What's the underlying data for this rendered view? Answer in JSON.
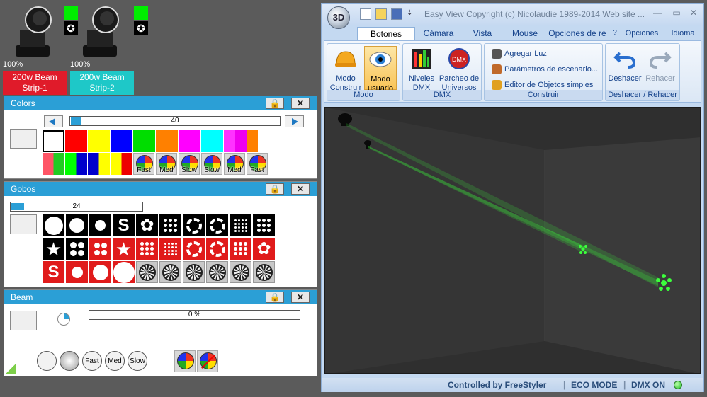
{
  "fixtures": [
    {
      "percent": "100%",
      "name": "200w Beam\nStrip-1",
      "name_color": "#e01b2a"
    },
    {
      "percent": "100%",
      "name": "200w Beam\nStrip-2",
      "name_color": "#1ec8c8"
    }
  ],
  "colors_panel": {
    "title": "Colors",
    "slider_value": "40",
    "slider_percent": 40,
    "row1": [
      "#ffffff",
      "#ff0000",
      "#ffff00",
      "#0000ff",
      "#00dd00",
      "#ff8000",
      "#ff00ff",
      "#00ffff"
    ],
    "macros": [
      "Fast",
      "Med",
      "Slow",
      "Slow",
      "Med",
      "Fast"
    ]
  },
  "gobos_panel": {
    "title": "Gobos",
    "slider_value": "24",
    "slider_percent": 24
  },
  "beam_panel": {
    "title": "Beam",
    "progress_text": "0 %",
    "progress_percent": 0,
    "macros": [
      "Fast",
      "Med",
      "Slow"
    ]
  },
  "window": {
    "title": "Easy View   Copyright (c) Nicolaudie 1989-2014   Web site ...",
    "orb": "3D",
    "tabs": [
      "Botones estánd",
      "Cámara",
      "Vista",
      "Mouse",
      "Opciones de re"
    ],
    "right_tabs": [
      "?",
      "Opciones",
      "Idioma"
    ],
    "groups": {
      "modo": {
        "label": "Modo",
        "construir": "Modo\nConstruir",
        "usuario": "Modo\nusuario"
      },
      "dmx": {
        "label": "DMX",
        "niveles": "Niveles\nDMX",
        "parcheo": "Parcheo de\nUniversos"
      },
      "construir": {
        "label": "Construir",
        "items": [
          "Agregar Luz",
          "Parámetros de escenario...",
          "Editor de Objetos simples"
        ]
      },
      "deshacer": {
        "label": "Deshacer / Rehacer",
        "undo": "Deshacer",
        "redo": "Rehacer"
      }
    },
    "status": {
      "controlled": "Controlled by FreeStyler",
      "eco": "ECO MODE",
      "dmx": "DMX ON"
    }
  },
  "colors": {
    "accent": "#2b9fd6",
    "beam": "#3cff3c"
  }
}
